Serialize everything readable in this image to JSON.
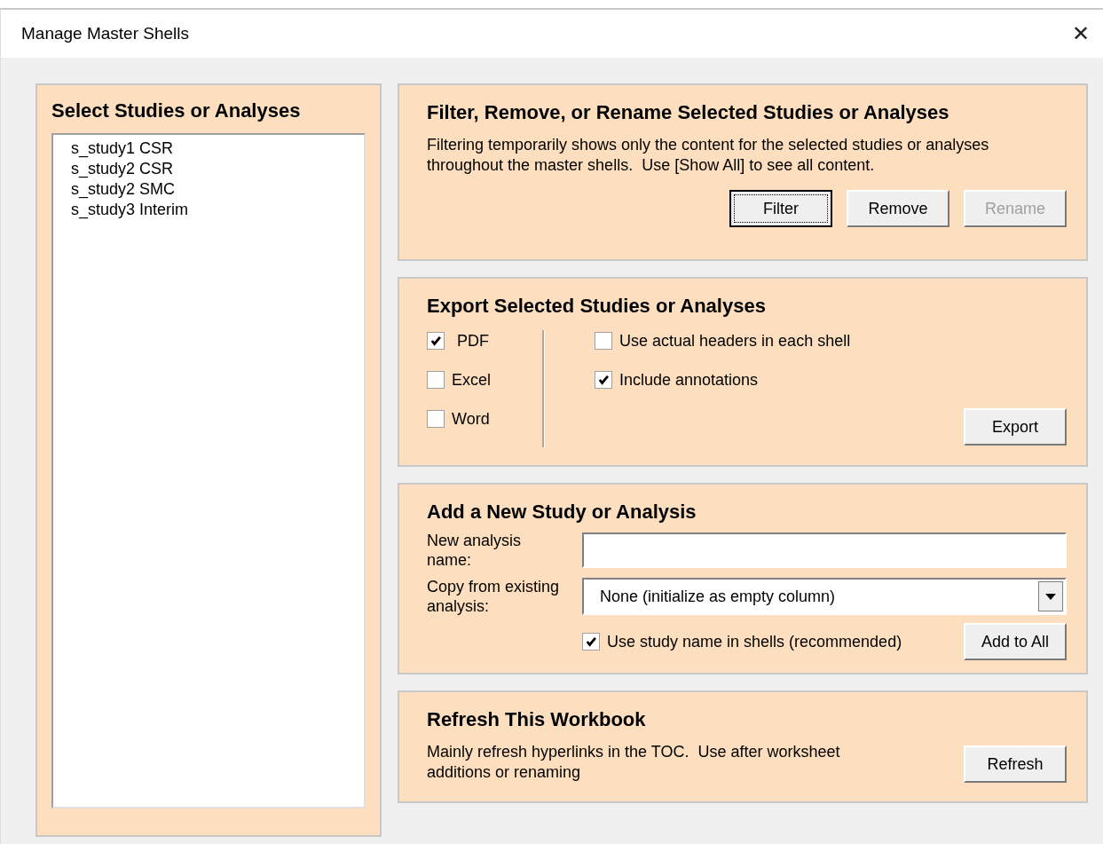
{
  "window": {
    "title": "Manage Master Shells",
    "close": "✕"
  },
  "studies": {
    "heading": "Select Studies or Analyses",
    "items": [
      {
        "label": "s_study1 CSR",
        "selected": false
      },
      {
        "label": "s_study2 CSR",
        "selected": false
      },
      {
        "label": "s_study2 SMC",
        "selected": false
      },
      {
        "label": "s_study3 Interim",
        "selected": false
      }
    ]
  },
  "filter_section": {
    "heading": "Filter, Remove, or Rename Selected Studies or Analyses",
    "description": "Filtering temporarily shows only the content for the selected studies or analyses throughout the master shells.  Use [Show All] to see all content.",
    "buttons": [
      {
        "label": "Filter",
        "focused": true,
        "disabled": false
      },
      {
        "label": "Remove",
        "focused": false,
        "disabled": false
      },
      {
        "label": "Rename",
        "focused": false,
        "disabled": true
      }
    ]
  },
  "export_section": {
    "heading": "Export Selected Studies or Analyses",
    "formats": [
      {
        "label": "PDF",
        "checked": true
      },
      {
        "label": "Excel",
        "checked": false
      },
      {
        "label": "Word",
        "checked": false
      }
    ],
    "options": [
      {
        "label": "Use actual headers in each shell",
        "checked": false
      },
      {
        "label": "Include annotations",
        "checked": true
      }
    ],
    "button": "Export"
  },
  "add_section": {
    "heading": "Add a New Study or Analysis",
    "name_label": "New analysis name:",
    "copy_label": "Copy from existing analysis:",
    "copy_value": "None (initialize as empty column)",
    "use_study_name": {
      "label": "Use study name in shells (recommended)",
      "checked": true
    },
    "button": "Add to All"
  },
  "refresh_section": {
    "heading": "Refresh This Workbook",
    "description": "Mainly refresh hyperlinks in the TOC.  Use after worksheet additions or renaming",
    "button": "Refresh"
  }
}
